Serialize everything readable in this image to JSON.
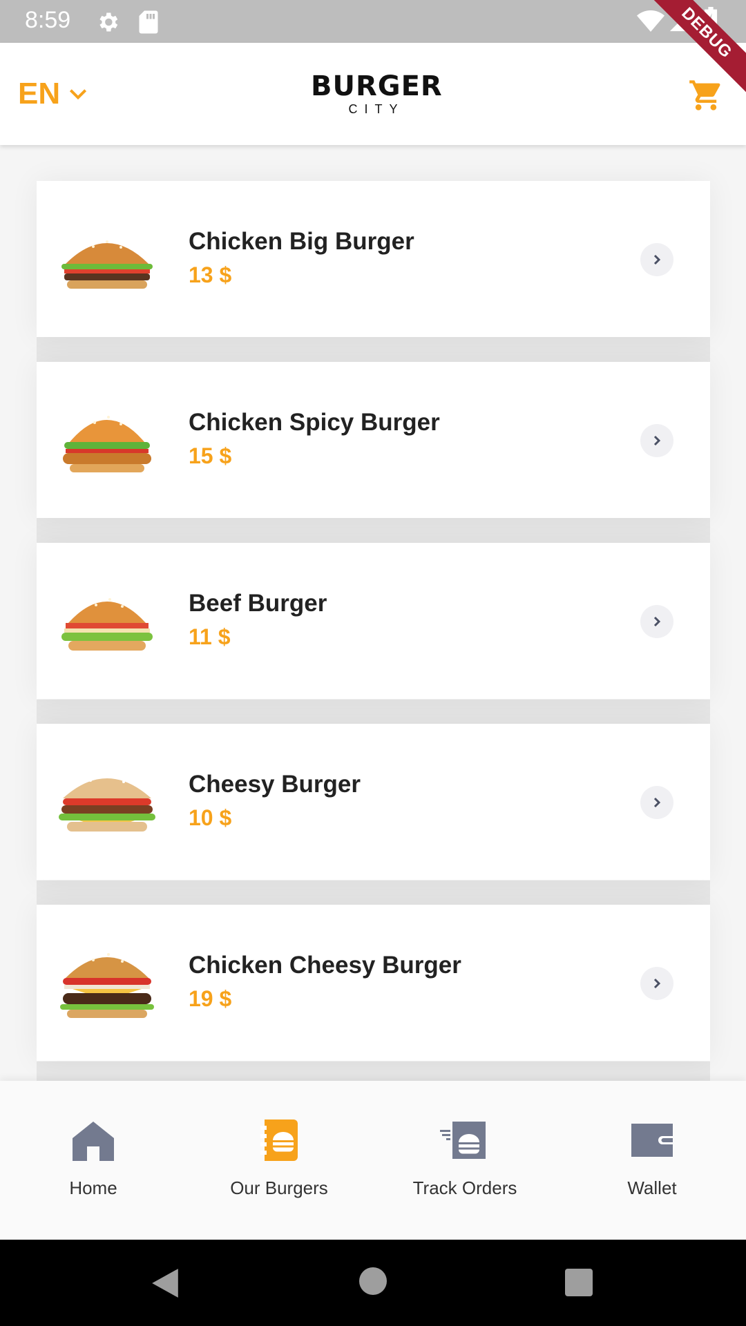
{
  "status_bar": {
    "time": "8:59",
    "icons": [
      "gear-icon",
      "sd-card-icon",
      "wifi-icon",
      "signal-icon",
      "battery-icon"
    ],
    "debug_label": "DEBUG"
  },
  "header": {
    "language": "EN",
    "brand_main": "BURGER",
    "brand_sub": "CITY",
    "accent_color": "#f7a21b"
  },
  "burgers": [
    {
      "name": "Chicken Big Burger",
      "price": "13 $"
    },
    {
      "name": "Chicken Spicy Burger",
      "price": "15 $"
    },
    {
      "name": "Beef Burger",
      "price": "11 $"
    },
    {
      "name": "Cheesy Burger",
      "price": "10 $"
    },
    {
      "name": "Chicken Cheesy Burger",
      "price": "19 $"
    }
  ],
  "bottom_nav": {
    "items": [
      {
        "label": "Home",
        "icon": "home-icon",
        "active": false
      },
      {
        "label": "Our Burgers",
        "icon": "menu-book-icon",
        "active": true
      },
      {
        "label": "Track Orders",
        "icon": "delivery-icon",
        "active": false
      },
      {
        "label": "Wallet",
        "icon": "wallet-icon",
        "active": false
      }
    ],
    "active_color": "#f7a21b",
    "inactive_color": "#737a8f"
  }
}
